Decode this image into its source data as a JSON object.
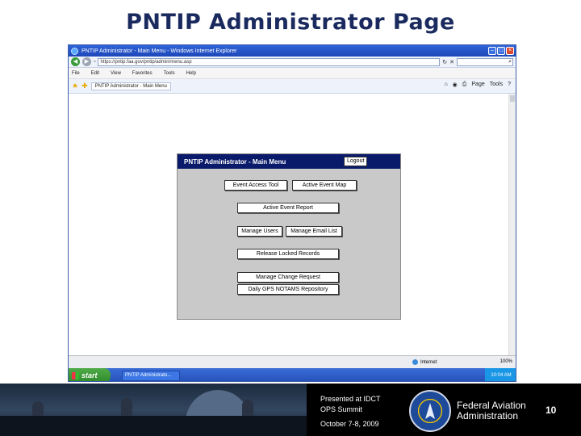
{
  "slide": {
    "title": "PNTIP Administrator Page",
    "footer": {
      "presented_line1": "Presented at IDCT",
      "presented_line2": "OPS Summit",
      "date": "October 7-8, 2009",
      "org_line1": "Federal Aviation",
      "org_line2": "Administration",
      "page_number": "10"
    }
  },
  "browser": {
    "window_title": "PNTIP Administrator - Main Menu - Windows Internet Explorer",
    "url": "https://pntip.faa.gov/pntip/admin/menu.asp",
    "menu": [
      "File",
      "Edit",
      "View",
      "Favorites",
      "Tools",
      "Help"
    ],
    "tab_label": "PNTIP Administrator - Main Menu",
    "toolbar": {
      "page_label": "Page",
      "tools_label": "Tools"
    },
    "status": {
      "zone": "Internet",
      "zoom": "100%"
    }
  },
  "admin_panel": {
    "header": "PNTIP Administrator - Main Menu",
    "logout": "Logout",
    "buttons": {
      "event_access_tool": "Event Access Tool",
      "active_event_map": "Active Event Map",
      "active_event_report": "Active Event Report",
      "manage_users": "Manage Users",
      "manage_email_list": "Manage Email List",
      "release_locked_records": "Release Locked Records",
      "manage_change_request": "Manage Change Request",
      "daily_repository": "Daily GPS NOTAMS Repository"
    }
  },
  "taskbar": {
    "start_label": "start",
    "task_label": "PNTIP Administrato...",
    "clock": "10:04 AM"
  }
}
